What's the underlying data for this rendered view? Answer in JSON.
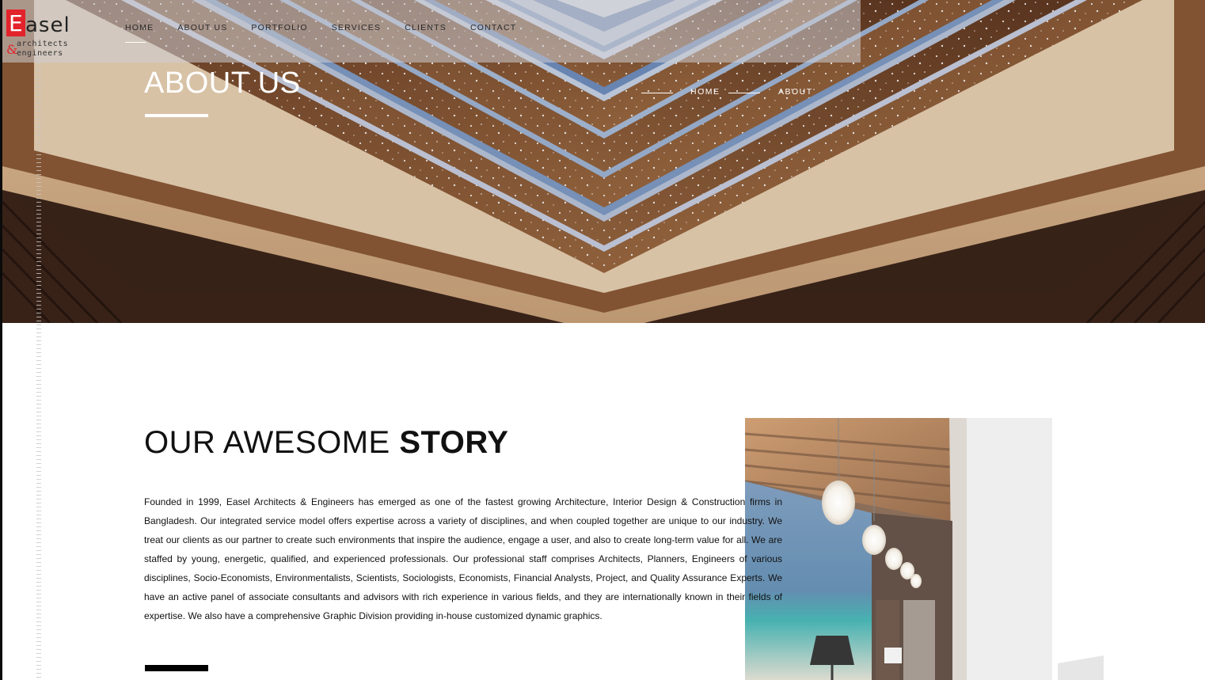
{
  "brand": {
    "logo_initial": "E",
    "logo_rest": "asel",
    "logo_ampersand": "&",
    "logo_line1": "architects",
    "logo_line2": "engineers",
    "accent_color": "#e3232b"
  },
  "nav": {
    "items": [
      {
        "label": "HOME",
        "active": true
      },
      {
        "label": "ABOUT US",
        "active": false
      },
      {
        "label": "PORTFOLIO",
        "active": false
      },
      {
        "label": "SERVICES",
        "active": false
      },
      {
        "label": "CLIENTS",
        "active": false
      },
      {
        "label": "CONTACT",
        "active": false
      }
    ]
  },
  "hero": {
    "title": "ABOUT US",
    "breadcrumb": {
      "home": "HOME",
      "current": "ABOUT"
    }
  },
  "story": {
    "heading_light": "OUR AWESOME",
    "heading_bold": "STORY",
    "body": "Founded in 1999, Easel Architects & Engineers has emerged as one of the fastest growing Architecture, Interior Design & Construction firms in Bangladesh. Our integrated service model offers expertise across a variety of disciplines, and when coupled together are unique to our industry. We treat our clients as our partner to create such environments that inspire the audience, engage a user, and also to create long-term value for all. We are staffed by young, energetic, qualified, and experienced professionals. Our professional staff comprises Architects, Planners, Engineers of various disciplines, Socio-Economists, Environmentalists, Scientists, Sociologists, Economists, Financial Analysts, Project, and Quality Assurance Experts. We have an active panel of associate consultants and advisors with rich experience in various fields, and they are internationally known in their fields of expertise. We also have a comprehensive Graphic Division providing in-house customized dynamic graphics."
  }
}
